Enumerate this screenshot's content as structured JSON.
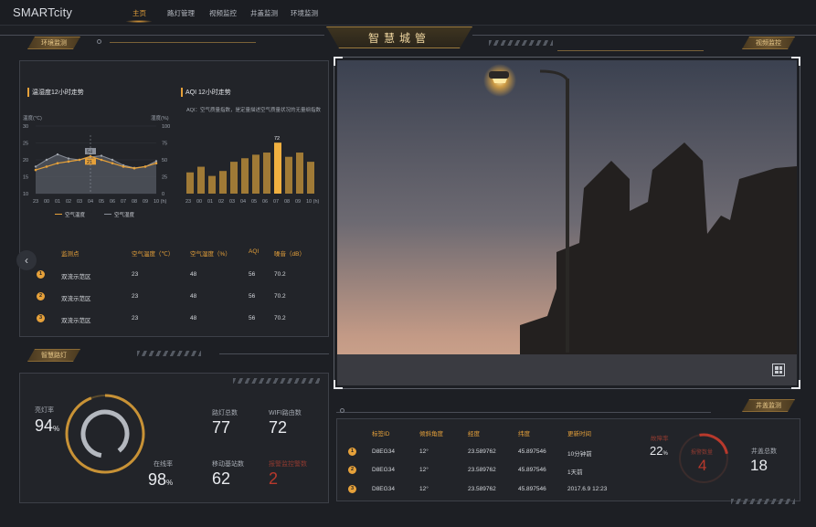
{
  "brand": "SMARTcity",
  "nav": [
    "主页",
    "路灯管理",
    "视频监控",
    "井盖监测",
    "环境监测"
  ],
  "center_title": "智慧城管",
  "tags": {
    "env": "环境监测",
    "video": "视频监控",
    "streetlight": "智慧路灯",
    "manhole": "井盖监测"
  },
  "env_chart": {
    "title": "温湿度12小时走势",
    "left_unit": "温度(℃)",
    "right_unit": "湿度(%)",
    "left_ticks": [
      "30",
      "25",
      "20",
      "15",
      "10"
    ],
    "right_ticks": [
      "100",
      "75",
      "50",
      "25",
      "0"
    ],
    "legend": [
      "空气温度",
      "空气湿度"
    ],
    "label_humidity": "54",
    "label_temp": "21"
  },
  "aqi_chart": {
    "title": "AQI 12小时走势",
    "subtitle": "AQI：空气质量指数，是定量描述空气质量状况的无量纲指数",
    "peak_label": "72"
  },
  "chart_data": [
    {
      "type": "line",
      "title": "温湿度12小时走势",
      "ylabel": "温度(℃)",
      "y2label": "湿度(%)",
      "x": [
        "23",
        "00",
        "01",
        "02",
        "03",
        "04",
        "05",
        "06",
        "07",
        "08",
        "09",
        "10 (h)"
      ],
      "ylim": [
        10,
        30
      ],
      "y2lim": [
        0,
        100
      ],
      "series": [
        {
          "name": "空气温度",
          "axis": "left",
          "values": [
            17,
            18,
            19,
            19.5,
            20,
            21,
            20,
            19,
            18,
            17.5,
            18,
            19
          ]
        },
        {
          "name": "空气湿度",
          "axis": "right",
          "values": [
            40,
            50,
            58,
            52,
            50,
            54,
            56,
            50,
            42,
            38,
            40,
            48
          ]
        }
      ]
    },
    {
      "type": "bar",
      "title": "AQI 12小时走势",
      "categories": [
        "23",
        "00",
        "01",
        "02",
        "03",
        "04",
        "05",
        "06",
        "07",
        "08",
        "09",
        "10 (h)"
      ],
      "values": [
        30,
        38,
        25,
        32,
        45,
        50,
        55,
        58,
        72,
        52,
        58,
        45
      ],
      "highlight_index": 8
    }
  ],
  "table": {
    "headers": [
      "监测点",
      "空气温度（℃）",
      "空气湿度（%）",
      "AQI",
      "噪音（dB）"
    ],
    "rows": [
      [
        "1",
        "双流示范区",
        "23",
        "48",
        "56",
        "70.2"
      ],
      [
        "2",
        "双流示范区",
        "23",
        "48",
        "56",
        "70.2"
      ],
      [
        "3",
        "双流示范区",
        "23",
        "48",
        "56",
        "70.2"
      ]
    ]
  },
  "streetlight": {
    "light_rate_label": "亮灯率",
    "light_rate": "94",
    "online_rate_label": "在线率",
    "online_rate": "98",
    "percent": "%",
    "total_label": "路灯总数",
    "total": "77",
    "wifi_label": "WIFI路由数",
    "wifi": "72",
    "base_label": "移动基站数",
    "base": "62",
    "alarm_label": "报警监控警数",
    "alarm": "2"
  },
  "manhole": {
    "headers": [
      "标签ID",
      "倾斜角度",
      "经度",
      "纬度",
      "更新时间"
    ],
    "rows": [
      [
        "1",
        "D8EG34",
        "12°",
        "23.589762",
        "45.897546",
        "10分钟前"
      ],
      [
        "2",
        "D8EG34",
        "12°",
        "23.589762",
        "45.897546",
        "1天前"
      ],
      [
        "3",
        "D8EG34",
        "12°",
        "23.589762",
        "45.897546",
        "2017.6.9  12:23"
      ]
    ],
    "fault_rate_label": "故障率",
    "fault_rate": "22",
    "percent": "%",
    "alarm_label": "报警数量",
    "alarm": "4",
    "total_label": "井盖总数",
    "total": "18"
  },
  "colors": {
    "accent": "#e6a13a",
    "alarm": "#c0392b",
    "background": "#1d1f24"
  }
}
